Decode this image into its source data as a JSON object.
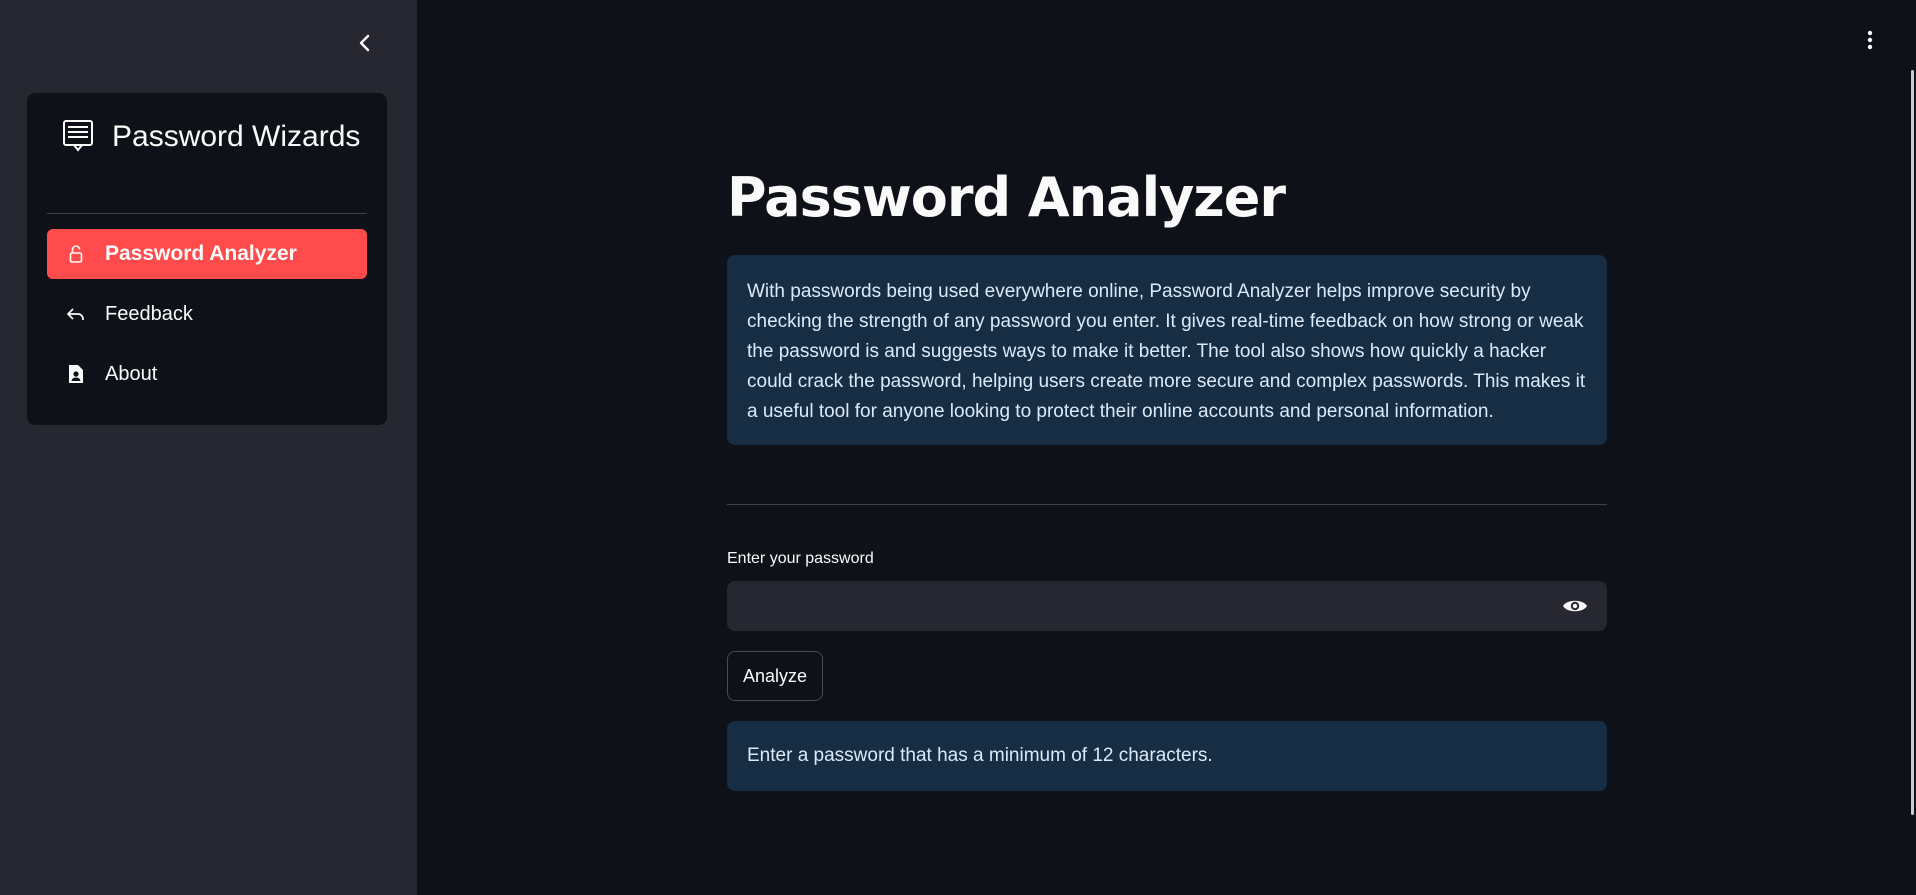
{
  "sidebar": {
    "brand_title": "Password Wizards",
    "brand_icon": "menu-card-icon",
    "collapse_icon": "chevron-left-icon",
    "items": [
      {
        "label": "Password Analyzer",
        "icon": "lock-icon",
        "active": true
      },
      {
        "label": "Feedback",
        "icon": "reply-icon",
        "active": false
      },
      {
        "label": "About",
        "icon": "file-person-icon",
        "active": false
      }
    ]
  },
  "header": {
    "menu_icon": "kebab-menu-icon"
  },
  "main": {
    "title": "Password Analyzer",
    "description": "With passwords being used everywhere online, Password Analyzer helps improve security by checking the strength of any password you enter. It gives real-time feedback on how strong or weak the password is and suggests ways to make it better. The tool also shows how quickly a hacker could crack the password, helping users create more secure and complex passwords. This makes it a useful tool for anyone looking to protect their online accounts and personal information.",
    "password_label": "Enter your password",
    "password_value": "",
    "password_placeholder": "",
    "analyze_label": "Analyze",
    "hint": "Enter a password that has a minimum of 12 characters."
  },
  "colors": {
    "accent": "#ff4b4b",
    "background": "#0e1117",
    "sidebar_bg": "#262730",
    "info_bg": "#172d43"
  }
}
